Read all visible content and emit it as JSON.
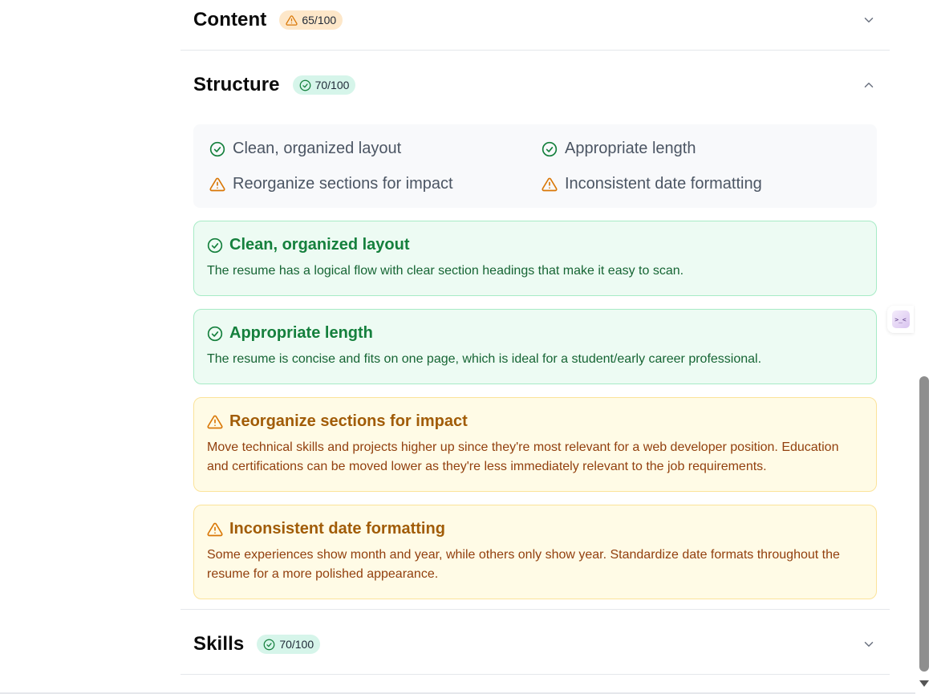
{
  "sections": {
    "content": {
      "title": "Content",
      "score": "65/100",
      "status": "warning",
      "expanded": false
    },
    "structure": {
      "title": "Structure",
      "score": "70/100",
      "status": "good",
      "expanded": true
    },
    "skills": {
      "title": "Skills",
      "score": "70/100",
      "status": "good",
      "expanded": false
    }
  },
  "structure_summary": [
    {
      "text": "Clean, organized layout",
      "status": "good",
      "icon": "check-circle-icon"
    },
    {
      "text": "Appropriate length",
      "status": "good",
      "icon": "check-circle-icon"
    },
    {
      "text": "Reorganize sections for impact",
      "status": "warning",
      "icon": "warning-triangle-icon"
    },
    {
      "text": "Inconsistent date formatting",
      "status": "warning",
      "icon": "warning-triangle-icon"
    }
  ],
  "structure_details": [
    {
      "title": "Clean, organized layout",
      "status": "good",
      "body": "The resume has a logical flow with clear section headings that make it easy to scan."
    },
    {
      "title": "Appropriate length",
      "status": "good",
      "body": "The resume is concise and fits on one page, which is ideal for a student/early career professional."
    },
    {
      "title": "Reorganize sections for impact",
      "status": "warning",
      "body": "Move technical skills and projects higher up since they're most relevant for a web developer position. Education and certifications can be moved lower as they're less immediately relevant to the job requirements."
    },
    {
      "title": "Inconsistent date formatting",
      "status": "warning",
      "body": "Some experiences show month and year, while others only show year. Standardize date formats throughout the resume for a more polished appearance."
    }
  ],
  "side_widget": {
    "glyph": ">_<"
  },
  "colors": {
    "good": "#15803d",
    "warning": "#d97706",
    "good_bg": "#edfbf3",
    "warning_bg": "#fffbe6"
  }
}
